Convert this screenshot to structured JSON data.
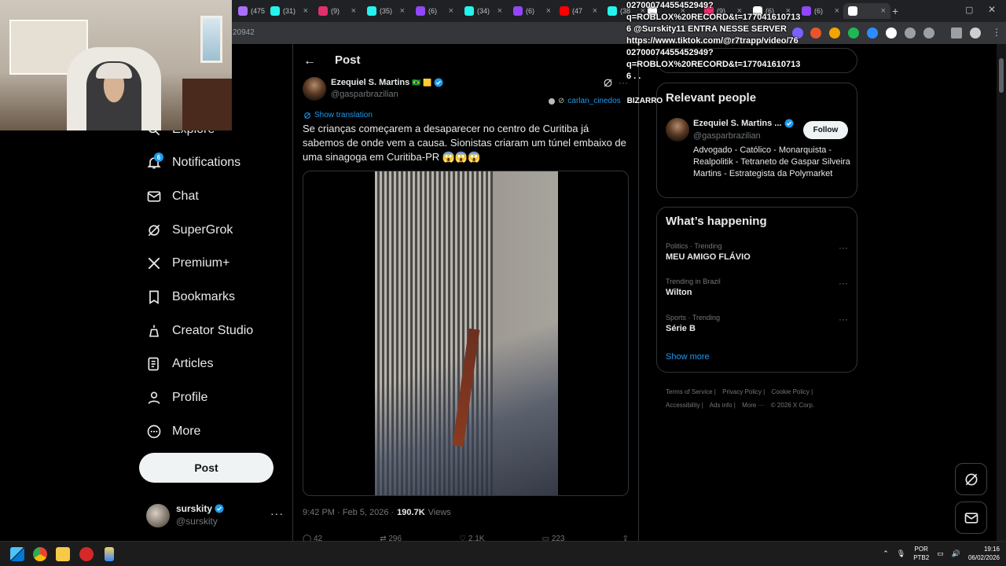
{
  "browser": {
    "tabs": [
      {
        "label": "(475",
        "color": "#a970ff"
      },
      {
        "label": "(31)",
        "color": "#25f4ee"
      },
      {
        "label": "(9)",
        "color": "#e1306c"
      },
      {
        "label": "(35)",
        "color": "#25f4ee"
      },
      {
        "label": "(6)",
        "color": "#9146ff"
      },
      {
        "label": "(34)",
        "color": "#25f4ee"
      },
      {
        "label": "(6)",
        "color": "#9146ff"
      },
      {
        "label": "(47",
        "color": "#ff0000"
      },
      {
        "label": "(38",
        "color": "#25f4ee"
      },
      {
        "label": "",
        "color": "#ffffff"
      },
      {
        "label": "(9)",
        "color": "#e1306c"
      },
      {
        "label": "(6)",
        "color": "#ffffff"
      },
      {
        "label": "(6)",
        "color": "#9146ff"
      },
      {
        "label": "",
        "color": "#ffffff"
      }
    ],
    "url_fragment": "20942"
  },
  "nav": {
    "items": [
      {
        "label": "Explore",
        "icon": "search-icon"
      },
      {
        "label": "Notifications",
        "icon": "bell-icon"
      },
      {
        "label": "Chat",
        "icon": "envelope-icon"
      },
      {
        "label": "SuperGrok",
        "icon": "grok-icon"
      },
      {
        "label": "Premium+",
        "icon": "x-logo-icon"
      },
      {
        "label": "Bookmarks",
        "icon": "bookmark-icon"
      },
      {
        "label": "Creator Studio",
        "icon": "creator-studio-icon"
      },
      {
        "label": "Articles",
        "icon": "article-icon"
      },
      {
        "label": "Profile",
        "icon": "person-icon"
      },
      {
        "label": "More",
        "icon": "more-circle-icon"
      }
    ],
    "notification_count": "6",
    "post_button": "Post",
    "account": {
      "name": "surskity",
      "handle": "@surskity",
      "more": "···"
    }
  },
  "post": {
    "header_title": "Post",
    "author": {
      "name": "Ezequiel S. Martins",
      "flags": "🇧🇷 🟨",
      "handle": "@gasparbrazilian"
    },
    "show_translation": "Show translation",
    "text": "Se crianças começarem a desaparecer no centro de Curitiba já sabemos de onde vem a causa. Sionistas criaram um túnel embaixo de uma sinagoga em Curitiba-PR 😱😱😱",
    "timestamp": "9:42 PM · Feb 5, 2026 ·",
    "views_count": "190.7K",
    "views_label": "Views",
    "actions": [
      "42",
      "296",
      "2.1K",
      "223"
    ]
  },
  "sidebar_right": {
    "relevant_people": {
      "title": "Relevant people",
      "name": "Ezequiel S. Martins ...",
      "handle": "@gasparbrazilian",
      "follow_label": "Follow",
      "bio": "Advogado - Católico - Monarquista - Realpolitik - Tetraneto de Gaspar Silveira Martins - Estrategista da Polymarket"
    },
    "whats_happening": {
      "title": "What’s happening",
      "trends": [
        {
          "meta": "Politics · Trending",
          "name": "MEU AMIGO FLÁVIO"
        },
        {
          "meta": "Trending in Brazil",
          "name": "Wilton"
        },
        {
          "meta": "Sports · Trending",
          "name": "Série B"
        }
      ],
      "show_more": "Show more"
    },
    "footer": [
      "Terms of Service |",
      "Privacy Policy |",
      "Cookie Policy |",
      "Accessibility |",
      "Ads info |",
      "More ···",
      "© 2026 X Corp."
    ]
  },
  "stream_overlay": {
    "text": "02700074455452949?\nq=ROBLOX%20RECORD&t=177041610713\n6 @Surskity11 ENTRA NESSE SERVER\nhttps://www.tiktok.com/@r7trapp/video/76\n02700074455452949?\nq=ROBLOX%20RECORD&t=177041610713\n6 . .",
    "tag_user": "carlan_cinedos",
    "tag_text": "BIZARRO"
  },
  "taskbar": {
    "lang_top": "POR",
    "lang_bottom": "PTB2",
    "time": "19:16",
    "date": "06/02/2026"
  },
  "colors": {
    "accent": "#1d9bf0",
    "background": "#000000",
    "border": "#2f3336",
    "muted": "#71767b"
  }
}
